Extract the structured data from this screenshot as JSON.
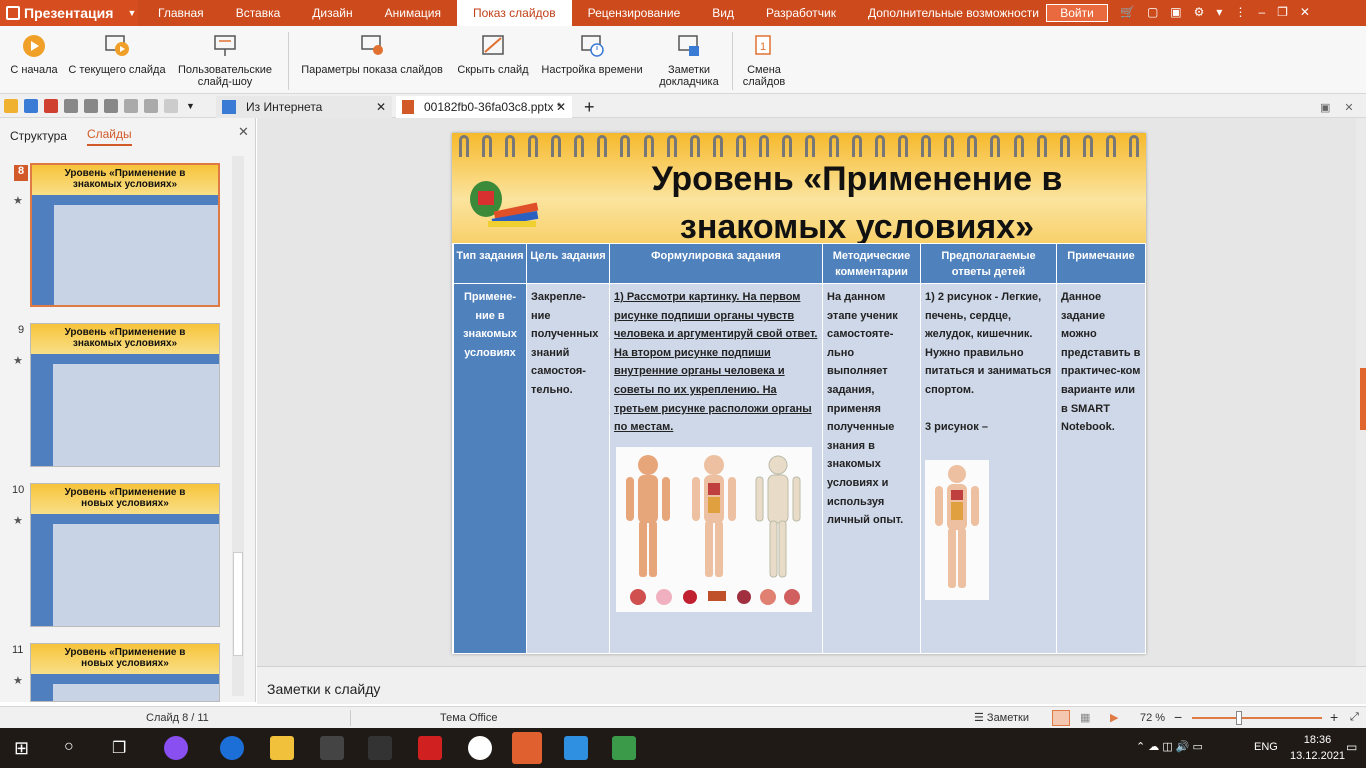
{
  "app": {
    "name": "Презентация"
  },
  "menu_tabs": [
    "Главная",
    "Вставка",
    "Дизайн",
    "Анимация",
    "Показ слайдов",
    "Рецензирование",
    "Вид",
    "Разработчик",
    "Дополнительные возможности"
  ],
  "active_tab": "Показ слайдов",
  "login_label": "Войти",
  "ribbon": {
    "from_start": "С начала",
    "from_current": "С текущего слайда",
    "custom_show_1": "Пользовательские",
    "custom_show_2": "слайд-шоу",
    "show_settings": "Параметры показа слайдов",
    "hide_slide": "Скрыть слайд",
    "rehearse": "Настройка времени",
    "notes_1": "Заметки",
    "notes_2": "докладчика",
    "switch_1": "Смена",
    "switch_2": "слайдов"
  },
  "doc_tabs": {
    "tab1": "Из Интернета",
    "tab2": "00182fb0-36fa03c8.pptx *"
  },
  "left_pane": {
    "structure": "Структура",
    "slides": "Слайды"
  },
  "thumbs": [
    {
      "num": "8",
      "title1": "Уровень «Применение в",
      "title2": "знакомых условиях»"
    },
    {
      "num": "9",
      "title1": "Уровень «Применение в",
      "title2": "знакомых условиях»"
    },
    {
      "num": "10",
      "title1": "Уровень «Применение в",
      "title2": "новых условиях»"
    },
    {
      "num": "11",
      "title1": "Уровень «Применение в",
      "title2": "новых условиях»"
    }
  ],
  "slide": {
    "title_line1": "Уровень «Применение в",
    "title_line2": "знакомых условиях»",
    "headers": [
      "Тип задания",
      "Цель задания",
      "Формулировка задания",
      "Методические комментарии",
      "Предполагаемые ответы детей",
      "Примечание"
    ],
    "col1": "Примене-ние в знакомых условиях",
    "col2": "Закрепле-ние полученных знаний самостоя-тельно.",
    "col3": "1) Рассмотри картинку. На первом рисунке подпиши органы чувств человека и аргументируй свой ответ. На втором рисунке подпиши внутренние органы человека и советы по их укреплению. На третьем рисунке расположи органы по местам.",
    "col4": "На данном этапе ученик самостояте-льно выполняет задания, применяя полученные знания в знакомых условиях и используя личный опыт.",
    "col5a": "1) 2 рисунок - Легкие, печень, сердце, желудок, кишечник.",
    "col5b": "Нужно правильно питаться и заниматься спортом.",
    "col5c": "3 рисунок –",
    "col6": "Данное задание можно представить в практичес-ком варианте или в SMART Notebook."
  },
  "notes_placeholder": "Заметки к слайду",
  "status": {
    "slide": "Слайд 8 / 11",
    "theme": "Тема Office",
    "notes": "Заметки",
    "zoom": "72 %"
  },
  "taskbar": {
    "lang": "ENG",
    "time": "18:36",
    "date": "13.12.2021"
  },
  "colors": {
    "accent": "#cc4a1c",
    "table_header": "#4f81bd",
    "table_cell": "#cfd8e8"
  }
}
